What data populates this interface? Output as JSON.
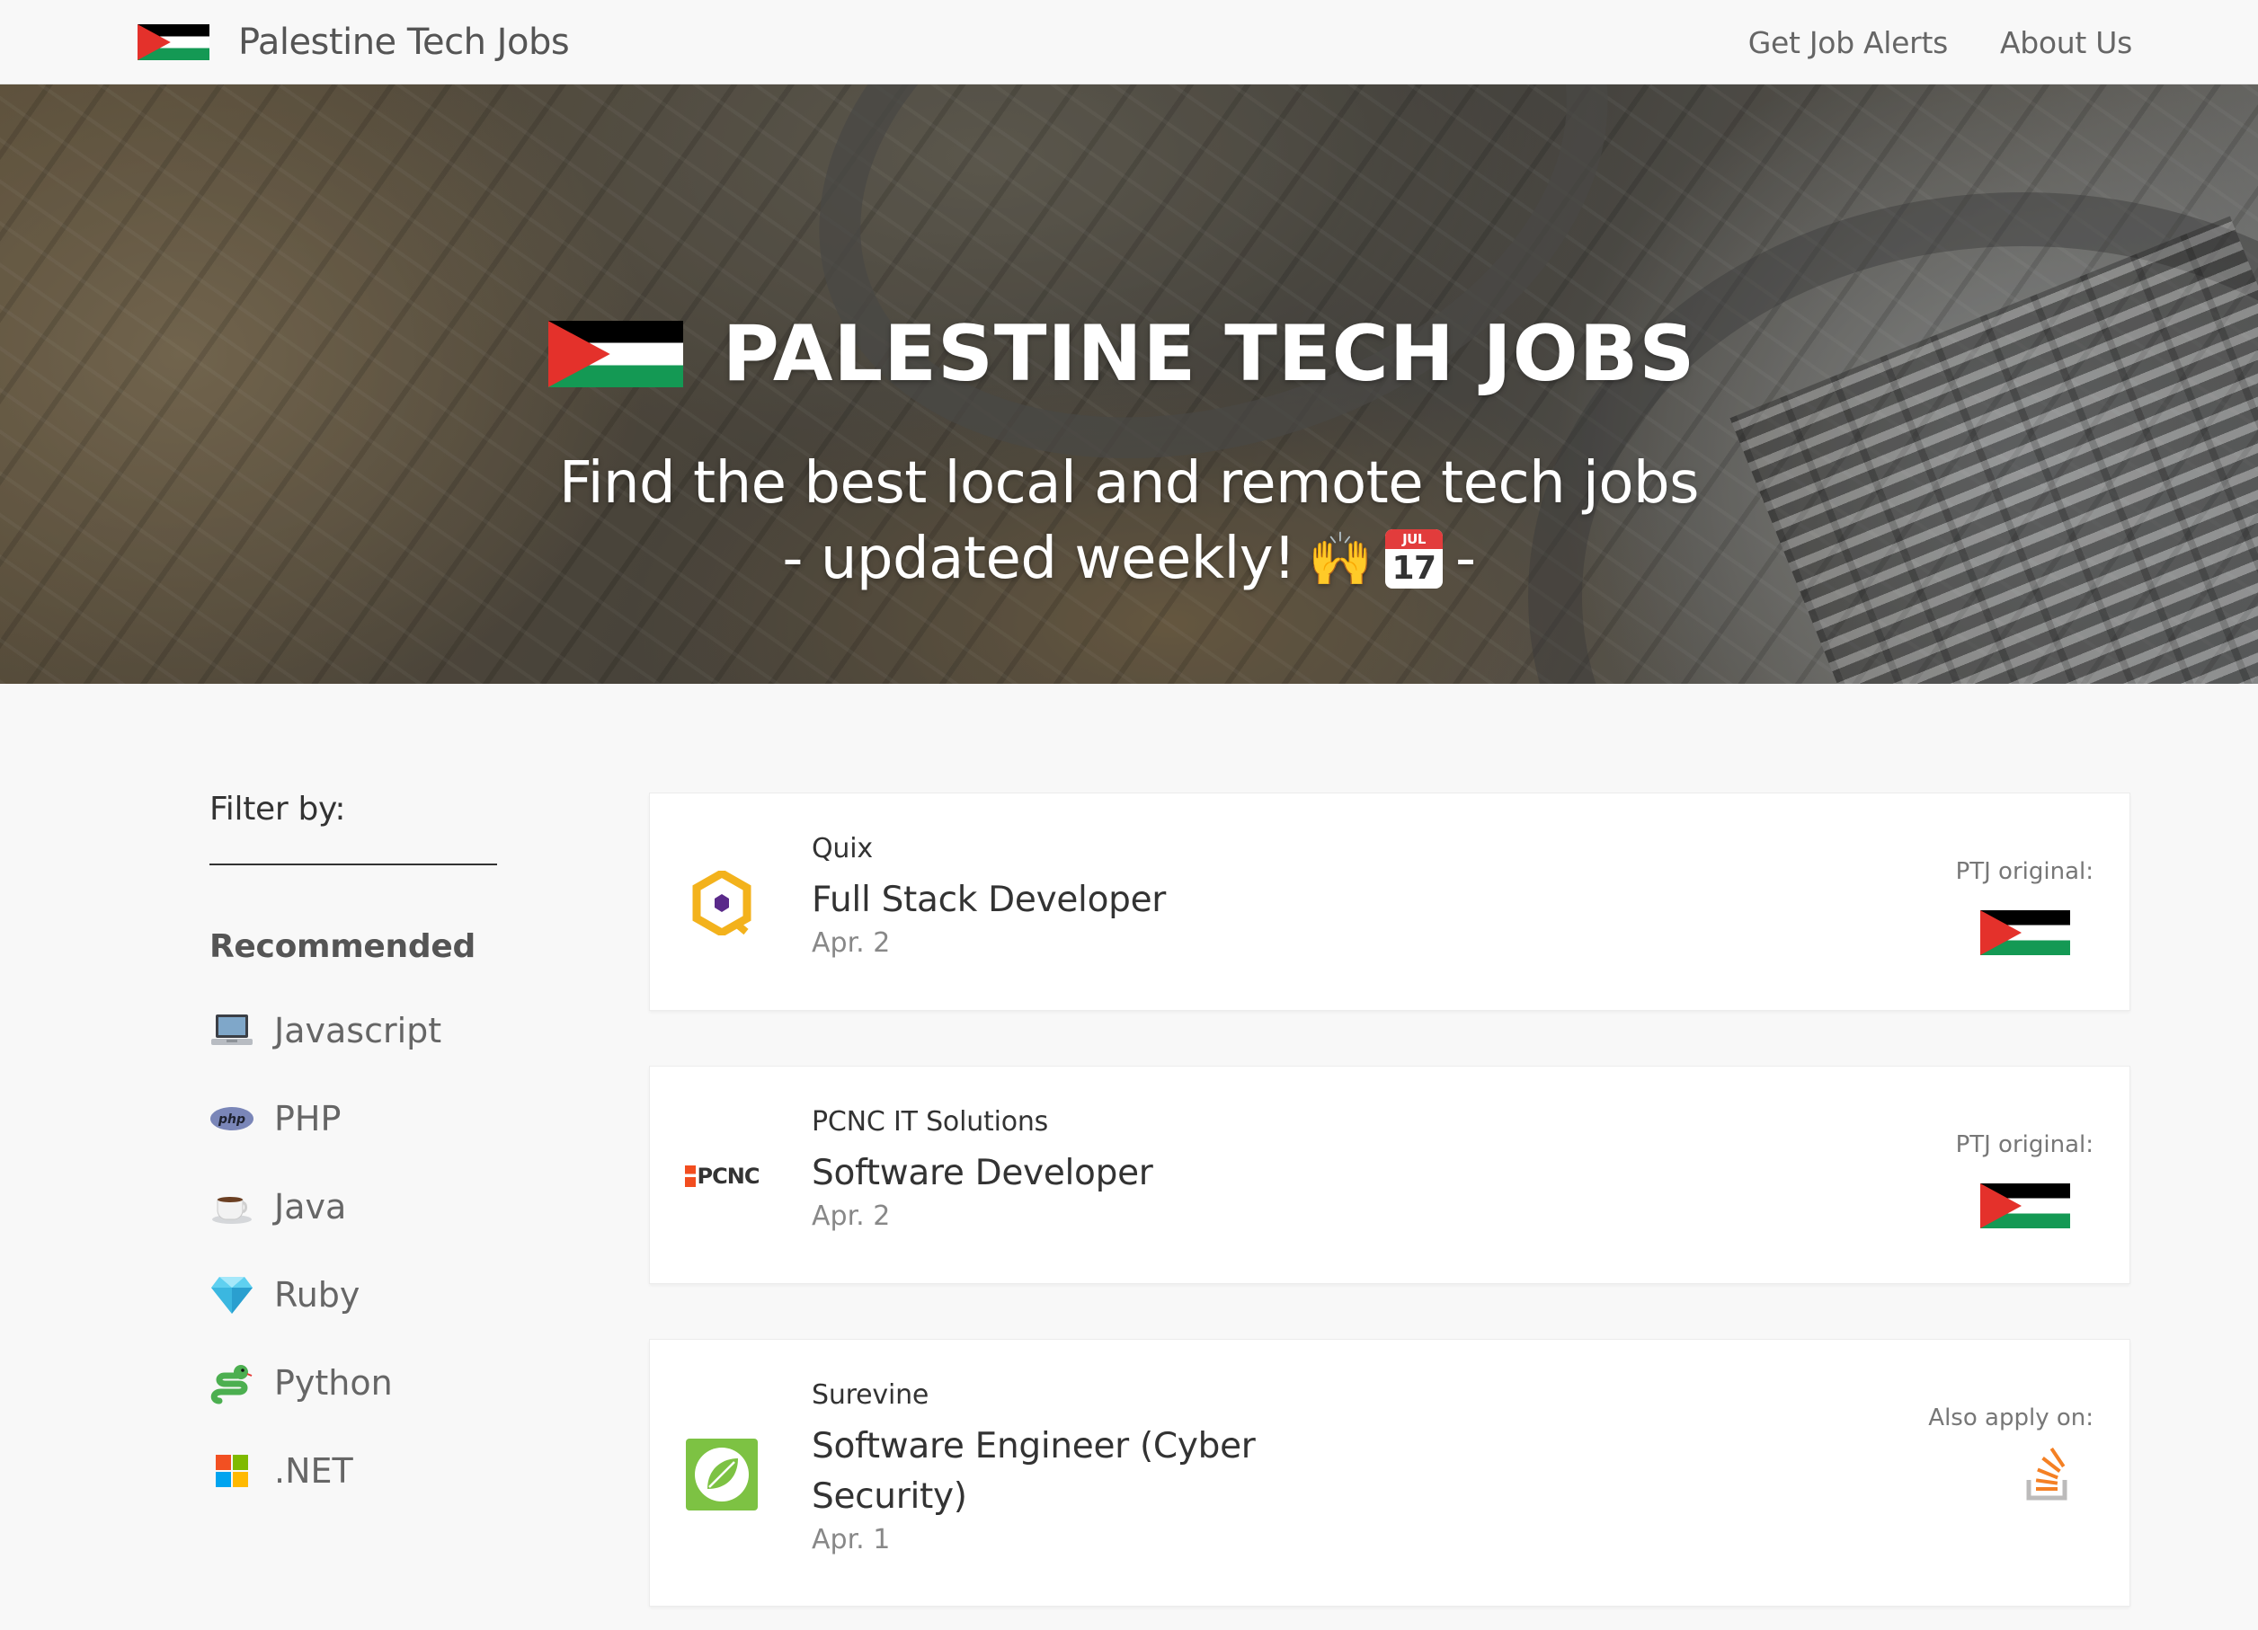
{
  "nav": {
    "brand": "Palestine Tech Jobs",
    "links": [
      "Get Job Alerts",
      "About Us"
    ]
  },
  "hero": {
    "title": "PALESTINE TECH JOBS",
    "subtitle_line1": "Find the best local and remote tech jobs",
    "subtitle_prefix": "- updated weekly!",
    "subtitle_suffix": "-",
    "calendar_month": "JUL",
    "calendar_day": "17"
  },
  "sidebar": {
    "filter_title": "Filter by:",
    "recommended_title": "Recommended",
    "items": [
      {
        "label": "Javascript",
        "icon": "laptop-icon"
      },
      {
        "label": "PHP",
        "icon": "php-icon"
      },
      {
        "label": "Java",
        "icon": "coffee-icon"
      },
      {
        "label": "Ruby",
        "icon": "gem-icon"
      },
      {
        "label": "Python",
        "icon": "snake-icon"
      },
      {
        "label": ".NET",
        "icon": "windows-icon"
      }
    ]
  },
  "jobs": [
    {
      "company": "Quix",
      "title": "Full Stack Developer",
      "date": "Apr. 2",
      "side_label": "PTJ original:"
    },
    {
      "company": "PCNC IT Solutions",
      "title": "Software Developer",
      "date": "Apr. 2",
      "side_label": "PTJ original:",
      "logo_text": "PCNC"
    },
    {
      "company": "Surevine",
      "title_line1": "Software Engineer (Cyber",
      "title_line2": "Security)",
      "date": "Apr. 1",
      "side_label": "Also apply on:"
    }
  ],
  "colors": {
    "flag_black": "#000000",
    "flag_green": "#149954",
    "flag_red": "#e4312b",
    "background": "#f8f8f8"
  }
}
